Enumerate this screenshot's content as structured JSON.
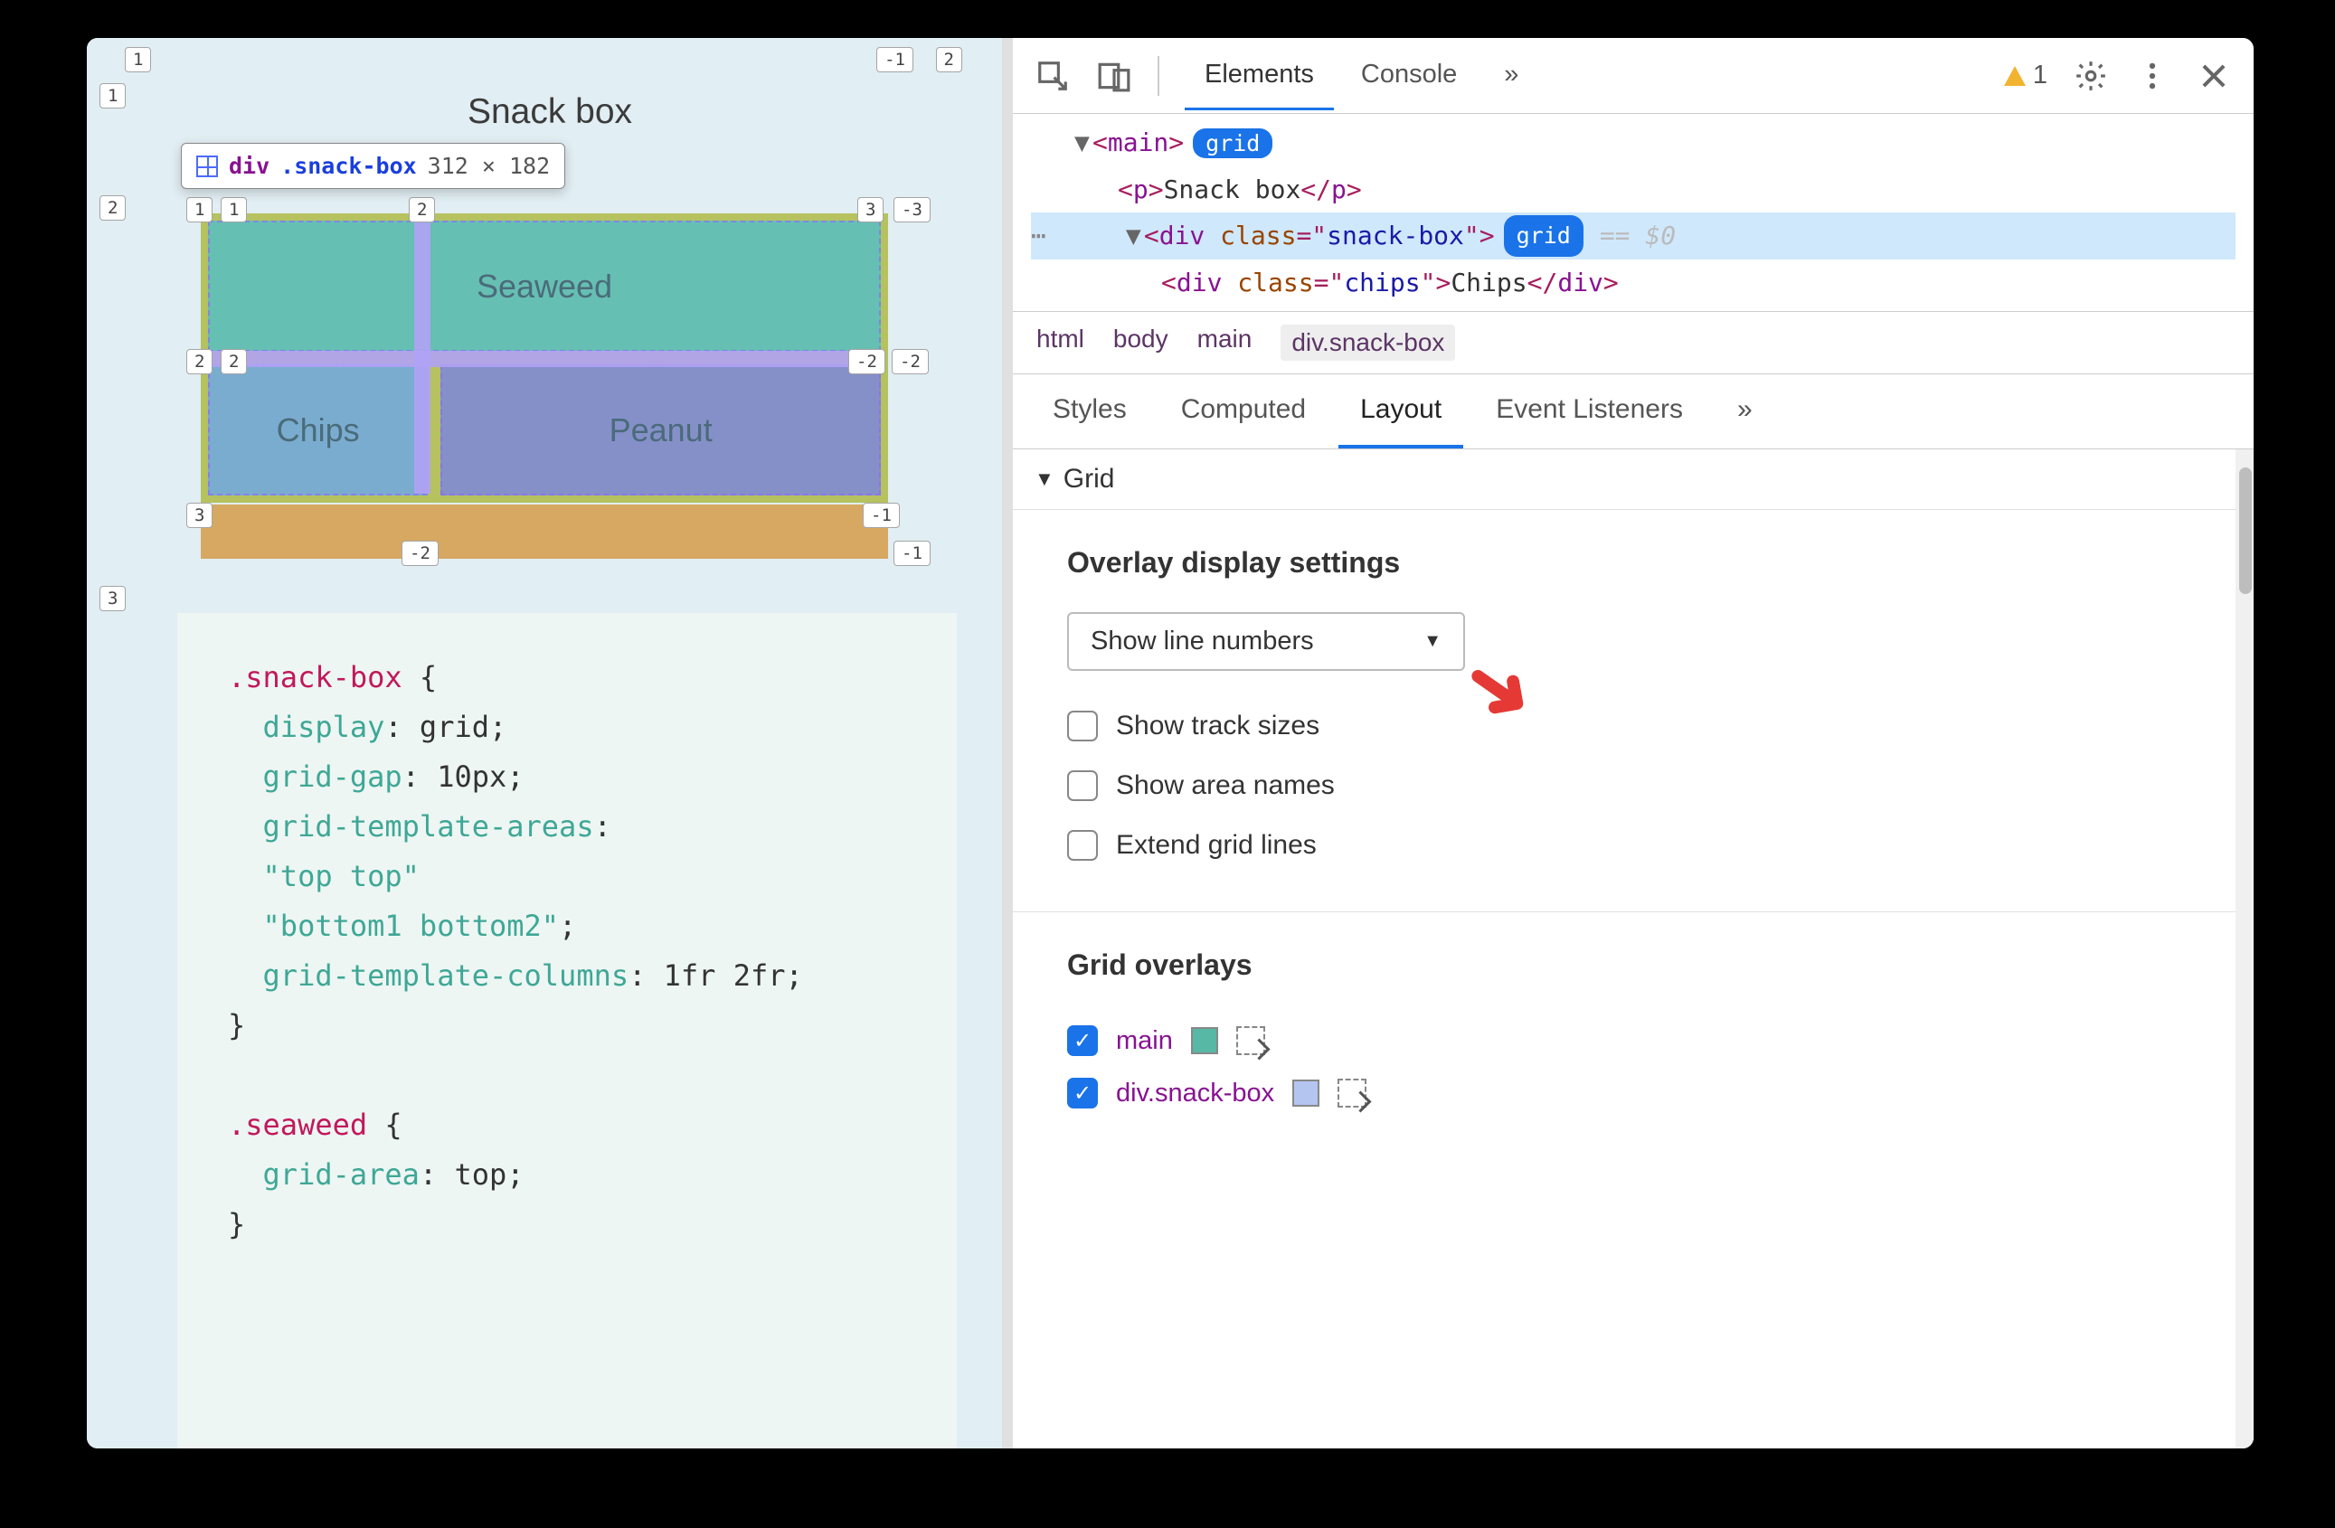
{
  "viewport": {
    "title": "Snack box",
    "tooltip": {
      "tag": "div",
      "cls": ".snack-box",
      "dims": "312 × 182"
    },
    "cells": {
      "seaweed": "Seaweed",
      "chips": "Chips",
      "peanut": "Peanut"
    },
    "outer_labels": {
      "c1": "1",
      "cn1": "-1",
      "c2": "2",
      "r1": "1",
      "r2": "2",
      "r3": "3"
    },
    "inner_labels": {
      "tl1a": "1",
      "tl1b": "1",
      "t2": "2",
      "tr3": "3",
      "trn3": "-3",
      "ml2a": "2",
      "ml2b": "2",
      "mrn2a": "-2",
      "mrn2b": "-2",
      "bl3": "3",
      "b2neg": "-2",
      "brn1a": "-1",
      "brn1b": "-1"
    },
    "code": {
      "l1a": ".snack-box",
      "l1b": " {",
      "l2a": "display",
      "l2b": ": grid;",
      "l3a": "grid-gap",
      "l3b": ": 10px;",
      "l4a": "grid-template-areas",
      "l4b": ":",
      "l5": "\"top top\"",
      "l6": "\"bottom1 bottom2\"",
      "l6b": ";",
      "l7a": "grid-template-columns",
      "l7b": ": 1fr 2fr;",
      "l8": "}",
      "l10a": ".seaweed",
      "l10b": " {",
      "l11a": "grid-area",
      "l11b": ": top;",
      "l12": "}"
    }
  },
  "devtools": {
    "toolbar": {
      "elements": "Elements",
      "console": "Console",
      "more": "»",
      "warn_count": "1"
    },
    "dom": {
      "main_open": "main",
      "grid_badge": "grid",
      "p_tag": "p",
      "p_text": "Snack box",
      "div_tag": "div",
      "class_attr": "class",
      "snack_val": "snack-box",
      "eq": "== $0",
      "chips_val": "chips",
      "chips_text": "Chips"
    },
    "crumbs": [
      "html",
      "body",
      "main",
      "div.snack-box"
    ],
    "subtabs": {
      "styles": "Styles",
      "computed": "Computed",
      "layout": "Layout",
      "listeners": "Event Listeners",
      "more": "»"
    },
    "grid_header": "Grid",
    "overlay_settings": {
      "title": "Overlay display settings",
      "select": "Show line numbers",
      "opt_track": "Show track sizes",
      "opt_area": "Show area names",
      "opt_extend": "Extend grid lines"
    },
    "overlays": {
      "title": "Grid overlays",
      "items": [
        {
          "name": "main",
          "color": "#57b8a5",
          "checked": true
        },
        {
          "name": "div.snack-box",
          "color": "#b4c5f0",
          "checked": true
        }
      ]
    }
  }
}
